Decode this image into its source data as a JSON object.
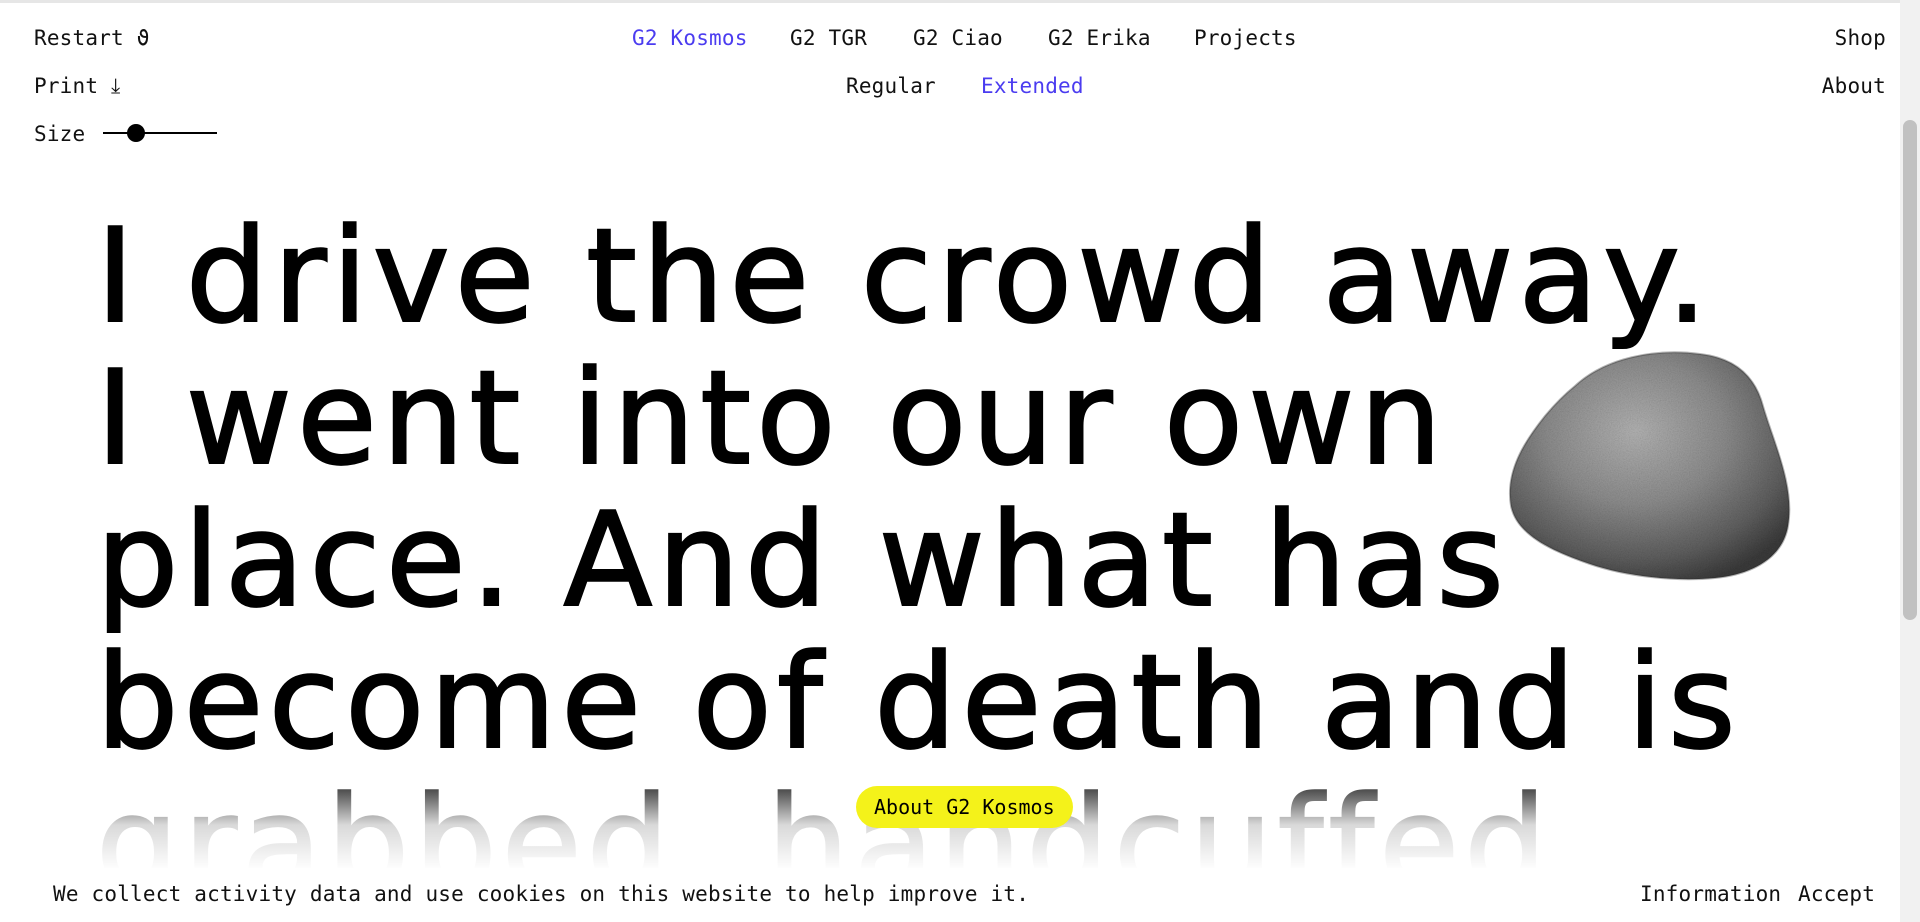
{
  "left_menu": {
    "restart_label": "Restart ϑ",
    "print_label": "Print ⤓",
    "size_label": "Size",
    "size_value": 0.25
  },
  "typeface_nav": {
    "items": [
      "G2 Kosmos",
      "G2 TGR",
      "G2 Ciao",
      "G2 Erika",
      "Projects"
    ],
    "active": "G2 Kosmos"
  },
  "style_nav": {
    "items": [
      "Regular",
      "Extended"
    ],
    "active": "Extended"
  },
  "right_menu": {
    "shop_label": "Shop",
    "about_label": "About"
  },
  "headline": {
    "lines": [
      "I drive the crowd away.",
      "I went into our own",
      "place. And what has",
      "become of death and is",
      "grabbed, handcuffed"
    ]
  },
  "about_pill": {
    "label": "About G2 Kosmos"
  },
  "cookie_bar": {
    "message": "We collect activity data and use cookies on this website to help improve it.",
    "information_label": "Information",
    "accept_label": "Accept"
  },
  "colors": {
    "accent": "#4b3cf0",
    "pill": "#f4f21a",
    "text": "#000000"
  }
}
